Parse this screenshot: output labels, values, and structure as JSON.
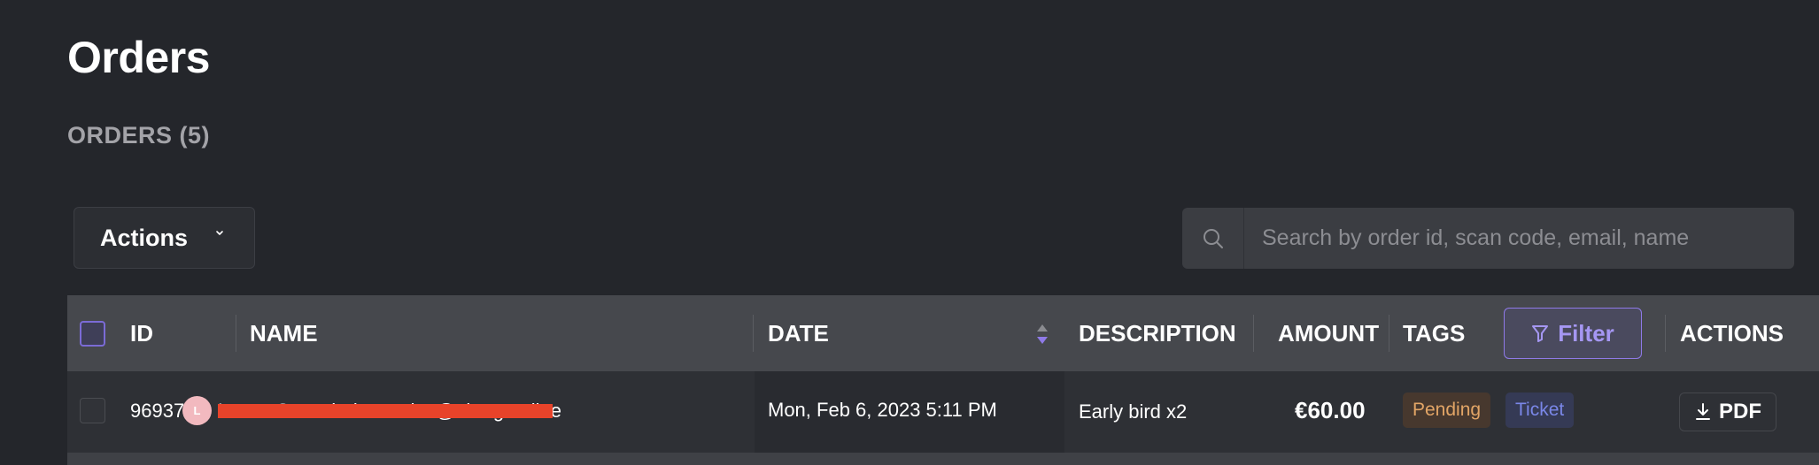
{
  "page": {
    "title": "Orders",
    "section_title": "ORDERS (5)"
  },
  "toolbar": {
    "actions_label": "Actions",
    "search_placeholder": "Search by order id, scan code, email, name"
  },
  "table": {
    "columns": {
      "id": "ID",
      "name": "NAME",
      "date": "DATE",
      "description": "DESCRIPTION",
      "amount": "AMOUNT",
      "tags": "TAGS",
      "actions": "ACTIONS"
    },
    "filter_label": "Filter",
    "rows": [
      {
        "id": "9693789",
        "avatar_initial": "L",
        "name": "Lucas Gerard · lucas.rice@ehotgmoline",
        "date": "Mon, Feb 6, 2023 5:11 PM",
        "description": "Early bird x2",
        "amount": "€60.00",
        "tags": [
          "Pending",
          "Ticket"
        ],
        "action_label": "PDF"
      }
    ]
  },
  "colors": {
    "background": "#24262b",
    "header_row": "#46484d",
    "accent": "#8f7ae8",
    "redaction": "#e8432a",
    "pending": "#e2a566",
    "ticket": "#7a87e8"
  },
  "icons": {
    "dropdown": "chevron-down-icon",
    "search": "search-icon",
    "sort": "sort-icon",
    "filter": "filter-icon",
    "download": "download-icon"
  }
}
